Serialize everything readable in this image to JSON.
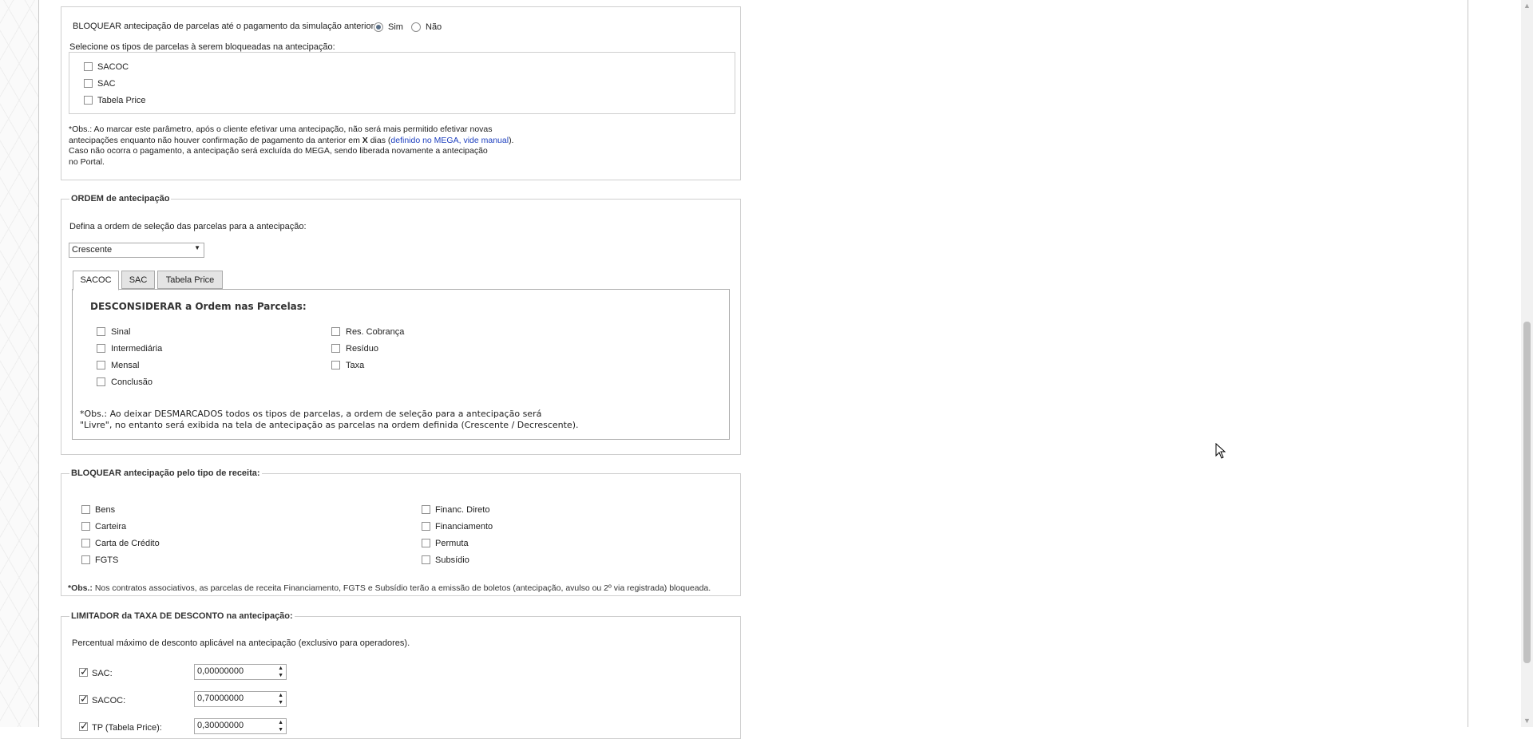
{
  "block_prev": {
    "question": "BLOQUEAR antecipação de parcelas até o pagamento da simulação anterior:",
    "opt_sim": "Sim",
    "opt_nao": "Não",
    "selected": "Sim",
    "types_label": "Selecione os tipos de parcelas à serem bloqueadas na antecipação:",
    "types": [
      {
        "label": "SACOC",
        "checked": false
      },
      {
        "label": "SAC",
        "checked": false
      },
      {
        "label": "Tabela Price",
        "checked": false
      }
    ],
    "obs_line1": "*Obs.: Ao marcar este parâmetro, após o cliente efetivar uma antecipação, não será mais permitido efetivar novas",
    "obs_line2_a": "antecipações enquanto não houver confirmação de pagamento da anterior em",
    "obs_line2_x": "X",
    "obs_line2_b": "dias (",
    "obs_line2_link": "definido no MEGA, vide manual",
    "obs_line2_c": ").",
    "obs_line3": "Caso não ocorra o pagamento, a antecipação será excluída do MEGA, sendo liberada novamente a antecipação",
    "obs_line4": "no Portal."
  },
  "ordem": {
    "legend": "ORDEM de antecipação",
    "label": "Defina a ordem de seleção das parcelas para a antecipação:",
    "select_value": "Crescente",
    "tabs": [
      "SACOC",
      "SAC",
      "Tabela Price"
    ],
    "active_tab": "SACOC",
    "panel_title": "DESCONSIDERAR a Ordem nas Parcelas:",
    "col1": [
      {
        "label": "Sinal",
        "checked": false
      },
      {
        "label": "Intermediária",
        "checked": false
      },
      {
        "label": "Mensal",
        "checked": false
      },
      {
        "label": "Conclusão",
        "checked": false
      }
    ],
    "col2": [
      {
        "label": "Res. Cobrança",
        "checked": false
      },
      {
        "label": "Resíduo",
        "checked": false
      },
      {
        "label": "Taxa",
        "checked": false
      }
    ],
    "obs_line1": "*Obs.: Ao deixar DESMARCADOS todos os tipos de parcelas, a ordem de seleção para a antecipação será",
    "obs_line2": "\"Livre\", no entanto será exibida na tela de antecipação as parcelas na ordem definida (Crescente / Decrescente)."
  },
  "receita": {
    "legend": "BLOQUEAR antecipação pelo tipo de receita:",
    "col1": [
      {
        "label": "Bens",
        "checked": false
      },
      {
        "label": "Carteira",
        "checked": false
      },
      {
        "label": "Carta de Crédito",
        "checked": false
      },
      {
        "label": "FGTS",
        "checked": false
      }
    ],
    "col2": [
      {
        "label": "Financ. Direto",
        "checked": false
      },
      {
        "label": "Financiamento",
        "checked": false
      },
      {
        "label": "Permuta",
        "checked": false
      },
      {
        "label": "Subsídio",
        "checked": false
      }
    ],
    "obs_bold": "*Obs.:",
    "obs_text": "Nos contratos associativos, as parcelas de receita Financiamento, FGTS e Subsídio terão a emissão de boletos (antecipação, avulso ou 2º via registrada) bloqueada."
  },
  "limitador": {
    "legend": "LIMITADOR da TAXA DE DESCONTO na antecipação:",
    "label": "Percentual máximo de desconto aplicável na antecipação (exclusivo para operadores).",
    "rows": [
      {
        "label": "SAC:",
        "checked": true,
        "value": "0,00000000"
      },
      {
        "label": "SACOC:",
        "checked": true,
        "value": "0,70000000"
      },
      {
        "label": "TP (Tabela Price):",
        "checked": true,
        "value": "0,30000000"
      }
    ]
  }
}
